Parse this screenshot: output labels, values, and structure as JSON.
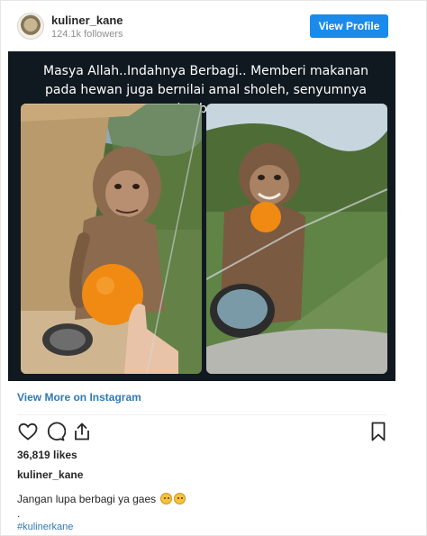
{
  "profile": {
    "username": "kuliner_kane",
    "followers": "124.1k followers",
    "view_profile_label": "View Profile"
  },
  "media": {
    "overlay_caption": "Masya Allah..Indahnya Berbagi.. Memberi makanan pada hewan juga bernilai amal sholeh, senyumnya tulus banget."
  },
  "links": {
    "view_more_label": "View More on Instagram"
  },
  "icons": {
    "like": "heart-icon",
    "comment": "comment-icon",
    "share": "share-icon",
    "save": "bookmark-icon"
  },
  "post": {
    "likes": "36,819 likes",
    "author": "kuliner_kane",
    "caption": "Jangan lupa berbagi ya gaes",
    "separator": ".",
    "hashtag": "#kulinerkane"
  },
  "colors": {
    "button_blue": "#1a8bea",
    "link_blue": "#2f7ab3",
    "media_background": "#101820"
  }
}
